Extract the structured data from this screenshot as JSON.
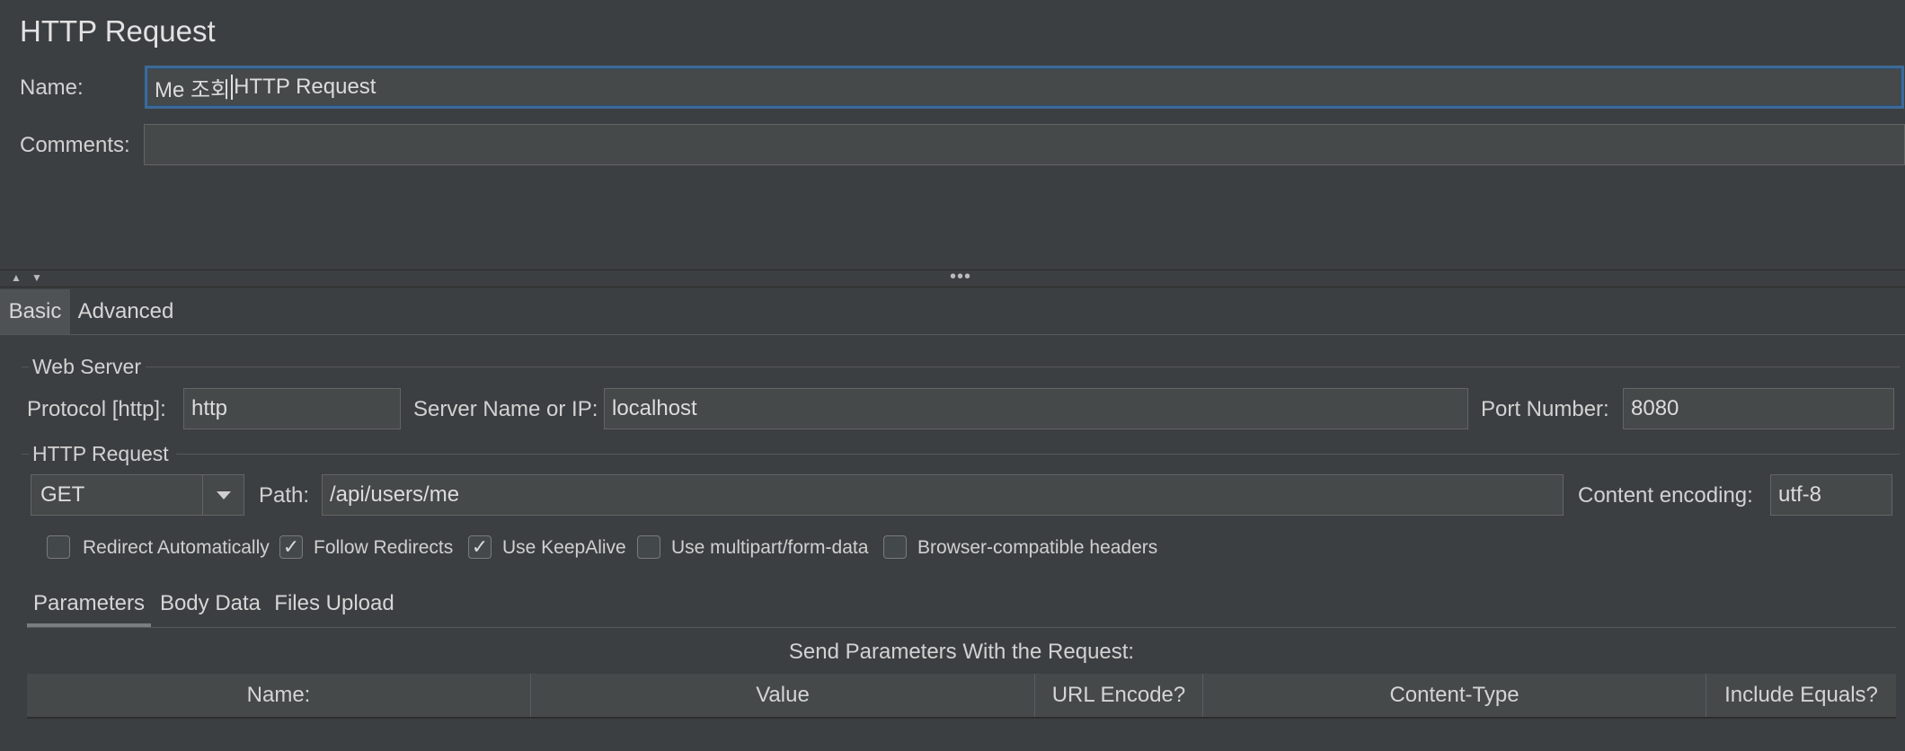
{
  "panel": {
    "title": "HTTP Request"
  },
  "name_field": {
    "label": "Name:",
    "value_before_caret": "Me 조회 ",
    "value_after_caret": "HTTP Request"
  },
  "comments_field": {
    "label": "Comments:",
    "value": ""
  },
  "splitter": {
    "up_icon": "triangle-up-icon",
    "down_icon": "triangle-down-icon",
    "grip": "•••"
  },
  "tabs": [
    {
      "label": "Basic",
      "selected": true
    },
    {
      "label": "Advanced",
      "selected": false
    }
  ],
  "web_server": {
    "legend": "Web Server",
    "protocol_label": "Protocol [http]:",
    "protocol_value": "http",
    "server_label": "Server Name or IP:",
    "server_value": "localhost",
    "port_label": "Port Number:",
    "port_value": "8080"
  },
  "http_request": {
    "legend": "HTTP Request",
    "method": "GET",
    "path_label": "Path:",
    "path_value": "/api/users/me",
    "encoding_label": "Content encoding:",
    "encoding_value": "utf-8"
  },
  "options": [
    {
      "label": "Redirect Automatically",
      "checked": false
    },
    {
      "label": "Follow Redirects",
      "checked": true
    },
    {
      "label": "Use KeepAlive",
      "checked": true
    },
    {
      "label": "Use multipart/form-data",
      "checked": false
    },
    {
      "label": "Browser-compatible headers",
      "checked": false
    }
  ],
  "sub_tabs": [
    {
      "label": "Parameters",
      "selected": true
    },
    {
      "label": "Body Data",
      "selected": false
    },
    {
      "label": "Files Upload",
      "selected": false
    }
  ],
  "params_table": {
    "caption": "Send Parameters With the Request:",
    "columns": [
      "Name:",
      "Value",
      "URL Encode?",
      "Content-Type",
      "Include Equals?"
    ]
  },
  "colors": {
    "background": "#3c3f41",
    "field": "#45494a",
    "focus_border": "#3d6a97"
  }
}
